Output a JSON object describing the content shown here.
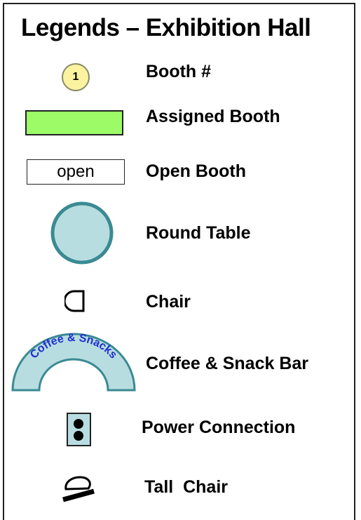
{
  "title": "Legends – Exhibition Hall",
  "legend": [
    {
      "label": "Booth #",
      "symbol_text": "1"
    },
    {
      "label": "Assigned Booth"
    },
    {
      "label": "Open Booth",
      "symbol_text": "open"
    },
    {
      "label": "Round Table"
    },
    {
      "label": "Chair"
    },
    {
      "label": "Coffee & Snack Bar",
      "symbol_text": "Coffee & Snacks"
    },
    {
      "label": "Power Connection"
    },
    {
      "label": "Tall  Chair"
    }
  ],
  "colors": {
    "booth_number_fill": "#fbf3a0",
    "assigned_booth_fill": "#9cfb67",
    "round_table_fill": "#b8dde0",
    "round_table_stroke": "#3a8a93",
    "coffee_bar_fill": "#b8dde0",
    "coffee_bar_text": "#1f2fd0",
    "power_fill": "#b8dde0"
  }
}
